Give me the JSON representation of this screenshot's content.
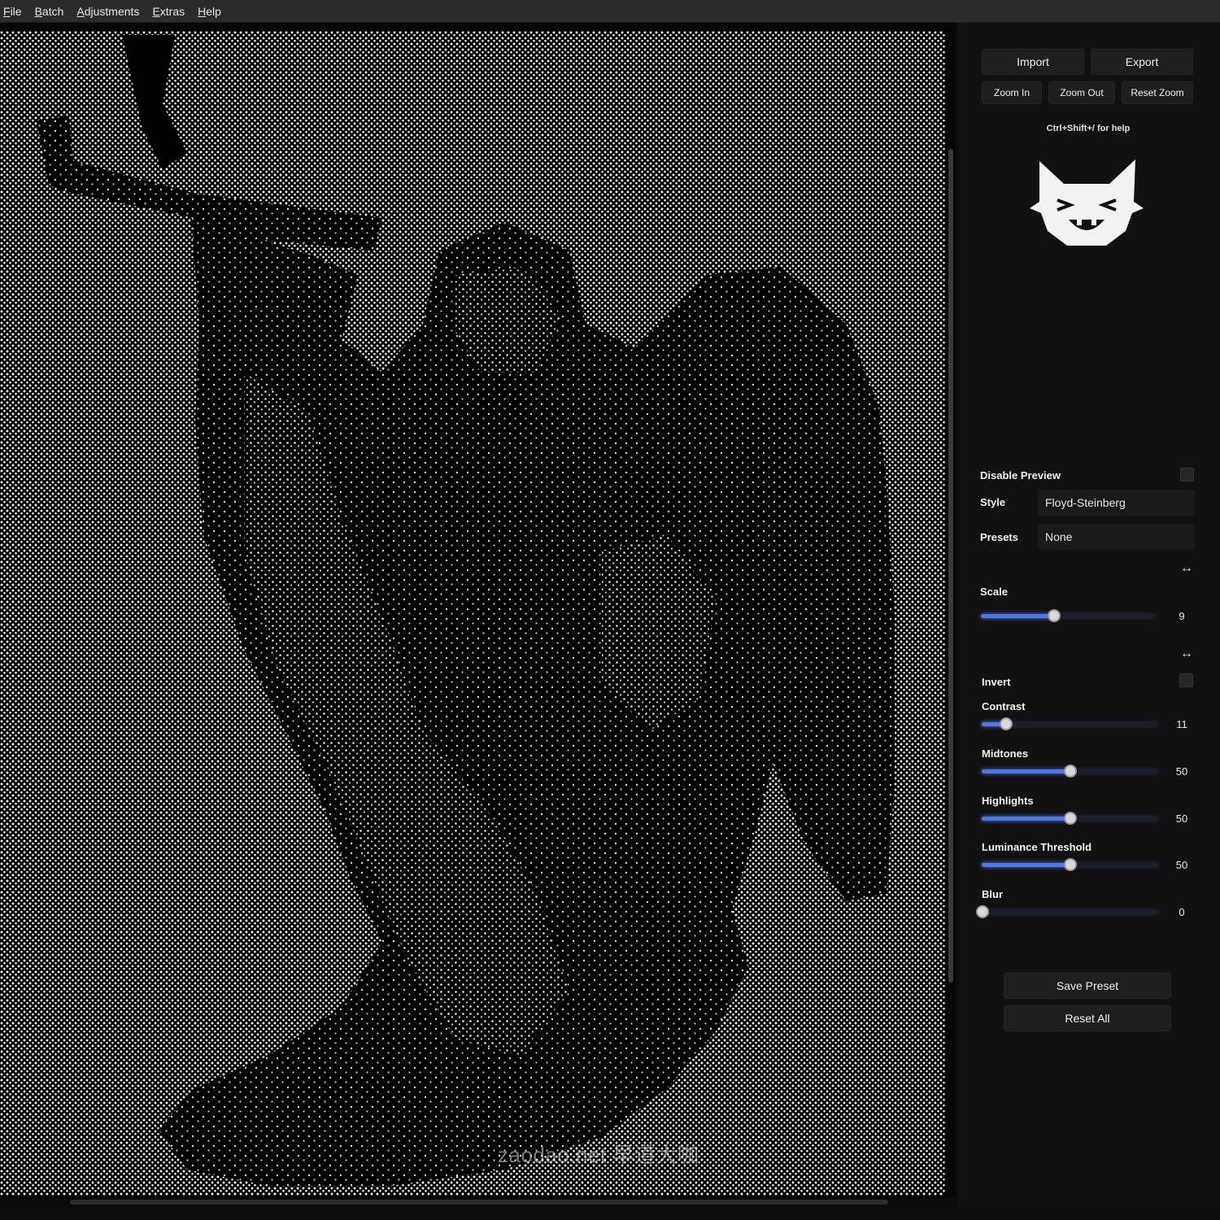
{
  "menu": {
    "items": [
      {
        "mnemonic": "F",
        "rest": "ile"
      },
      {
        "mnemonic": "B",
        "rest": "atch"
      },
      {
        "mnemonic": "A",
        "rest": "djustments"
      },
      {
        "mnemonic": "E",
        "rest": "xtras"
      },
      {
        "mnemonic": "H",
        "rest": "elp"
      }
    ]
  },
  "toolbar": {
    "import_label": "Import",
    "export_label": "Export",
    "zoom_in_label": "Zoom In",
    "zoom_out_label": "Zoom Out",
    "reset_zoom_label": "Reset Zoom"
  },
  "help_hint": "Ctrl+Shift+/ for help",
  "settings": {
    "disable_preview_label": "Disable Preview",
    "disable_preview_checked": false,
    "style_label": "Style",
    "style_value": "Floyd-Steinberg",
    "presets_label": "Presets",
    "presets_value": "None",
    "invert_label": "Invert",
    "invert_checked": false
  },
  "sliders": {
    "scale": {
      "label": "Scale",
      "value": "9",
      "fraction": 0.42
    },
    "contrast": {
      "label": "Contrast",
      "value": "11",
      "fraction": 0.14
    },
    "midtones": {
      "label": "Midtones",
      "value": "50",
      "fraction": 0.5
    },
    "highlights": {
      "label": "Highlights",
      "value": "50",
      "fraction": 0.5
    },
    "luminance": {
      "label": "Luminance Threshold",
      "value": "50",
      "fraction": 0.5
    },
    "blur": {
      "label": "Blur",
      "value": "0",
      "fraction": 0.0
    }
  },
  "actions": {
    "save_preset_label": "Save Preset",
    "reset_all_label": "Reset All"
  },
  "watermark": "zaodao.net 早道大咖",
  "colors": {
    "accent": "#4f78e6",
    "panel_bg": "#111111",
    "menubar_bg": "#2b2b2b"
  },
  "canvas": {
    "content": "dithered dot-pattern image of an angel statue holding a cross"
  }
}
